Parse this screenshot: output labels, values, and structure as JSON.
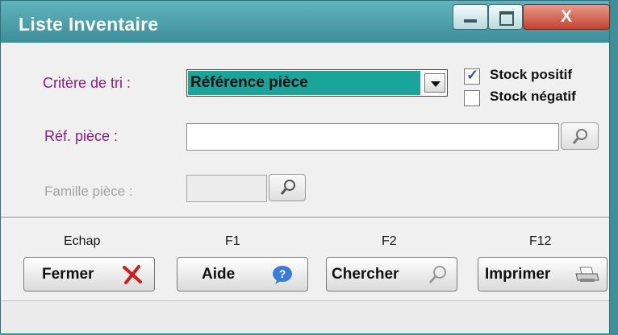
{
  "window": {
    "title": "Liste Inventaire",
    "close_glyph": "X"
  },
  "colors": {
    "titlebar": "#4aa0ab",
    "label": "#8a1f82",
    "selected_bg": "#1aa59a",
    "close": "#c24430"
  },
  "form": {
    "sort_label": "Critère de tri :",
    "sort_value": "Référence pièce",
    "stock_positive": {
      "label": "Stock positif",
      "checked": true
    },
    "stock_negative": {
      "label": "Stock négatif",
      "checked": false
    },
    "ref_label": "Réf. pièce :",
    "ref_value": "",
    "family_label": "Famille pièce :",
    "family_value": ""
  },
  "actions": [
    {
      "key": "Echap",
      "label": "Fermer",
      "icon": "red-x-icon"
    },
    {
      "key": "F1",
      "label": "Aide",
      "icon": "help-icon"
    },
    {
      "key": "F2",
      "label": "Chercher",
      "icon": "magnifier-icon"
    },
    {
      "key": "F12",
      "label": "Imprimer",
      "icon": "printer-icon"
    }
  ]
}
